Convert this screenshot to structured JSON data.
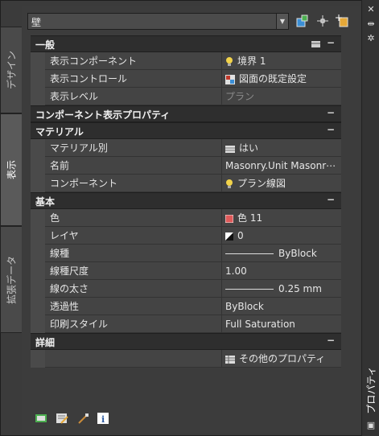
{
  "left_tabs": [
    {
      "label": "デザイン",
      "active": false
    },
    {
      "label": "表示",
      "active": true
    },
    {
      "label": "拡張データ",
      "active": false
    }
  ],
  "object_selector": {
    "value": "壁"
  },
  "palette_title": "プロパティ",
  "sections": [
    {
      "title": "一般",
      "rows": [
        {
          "name": "表示コンポーネント",
          "value": "境界 1",
          "icon": "bulb-icon"
        },
        {
          "name": "表示コントロール",
          "value": "図面の既定設定",
          "icon": "display-control-icon"
        },
        {
          "name": "表示レベル",
          "value": "プラン",
          "icon": "",
          "dim": true
        }
      ]
    },
    {
      "title": "コンポーネント表示プロパティ",
      "rows": []
    },
    {
      "title": "マテリアル",
      "rows": [
        {
          "name": "マテリアル別",
          "value": "はい",
          "icon": "material-icon"
        },
        {
          "name": "名前",
          "value": "Masonry.Unit  Masonr⋯",
          "icon": ""
        },
        {
          "name": "コンポーネント",
          "value": "プラン線図",
          "icon": "bulb-icon"
        }
      ]
    },
    {
      "title": "基本",
      "rows": [
        {
          "name": "色",
          "value": "色 11",
          "icon": "color-swatch-icon"
        },
        {
          "name": "レイヤ",
          "value": "0",
          "icon": "layer-icon"
        },
        {
          "name": "線種",
          "value": "ByBlock",
          "icon": "linetype-icon"
        },
        {
          "name": "線種尺度",
          "value": "1.00",
          "icon": ""
        },
        {
          "name": "線の太さ",
          "value": "0.25 mm",
          "icon": "lineweight-icon"
        },
        {
          "name": "透過性",
          "value": "ByBlock",
          "icon": ""
        },
        {
          "name": "印刷スタイル",
          "value": "Full Saturation",
          "icon": ""
        }
      ]
    },
    {
      "title": "詳細",
      "rows": [
        {
          "name": "",
          "value": "その他のプロパティ",
          "icon": "table-icon"
        }
      ]
    }
  ],
  "colors": {
    "swatch_red": "#e05a5a",
    "bulb_yellow": "#f2d34a",
    "accent_blue": "#3b8fd6"
  }
}
